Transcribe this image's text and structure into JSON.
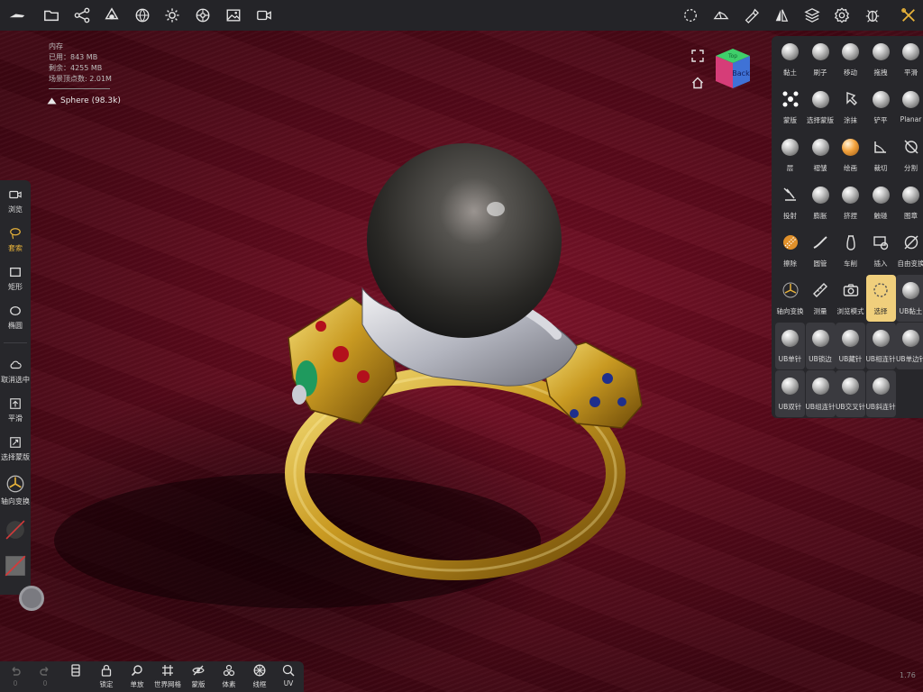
{
  "stats": {
    "memory_title": "内存",
    "used": "已用：843 MB",
    "remaining": "剩余：4255 MB",
    "vertices": "场景顶点数: 2.01M"
  },
  "mesh_label": "Sphere (98.3k)",
  "nav_cube": {
    "face_front": "Back",
    "face_top": "Top"
  },
  "left_panel": {
    "view": "浏览",
    "lasso": "套索",
    "rect": "矩形",
    "ellipse": "椭圆",
    "deselect": "取消选中",
    "smooth": "平滑",
    "select_mask": "选择蒙版",
    "axis_transform": "轴向变换"
  },
  "tools": [
    [
      "黏土",
      "刷子",
      "移动",
      "拖拽",
      "平滑"
    ],
    [
      "蒙版",
      "选择蒙版",
      "涂抹",
      "铲平",
      "Planar"
    ],
    [
      "层",
      "褶皱",
      "绘画",
      "裁切",
      "分割"
    ],
    [
      "投射",
      "膨胀",
      "挤捏",
      "触碰",
      "图章"
    ],
    [
      "擦除",
      "圆管",
      "车削",
      "插入",
      "自由变换"
    ],
    [
      "轴向变换",
      "测量",
      "浏览模式",
      "选择",
      "UB黏土"
    ],
    [
      "UB单针",
      "UB锁边",
      "UB藏针",
      "UB相连针",
      "UB单边针"
    ],
    [
      "UB双针",
      "UB组连针",
      "UB交叉针",
      "UB斜连针"
    ]
  ],
  "bottom_bar": {
    "undo_count": "0",
    "redo_count": "0",
    "lock": "锁定",
    "solo": "单放",
    "world_grid": "世界网格",
    "mask": "蒙版",
    "voxel": "体素",
    "wireframe": "线框",
    "uv": "UV"
  },
  "version": "1.76",
  "colors": {
    "accent": "#e8b33a",
    "selected_tool_bg": "#f0cf7c",
    "panel": "#27272b",
    "background": "#6a0c20"
  }
}
